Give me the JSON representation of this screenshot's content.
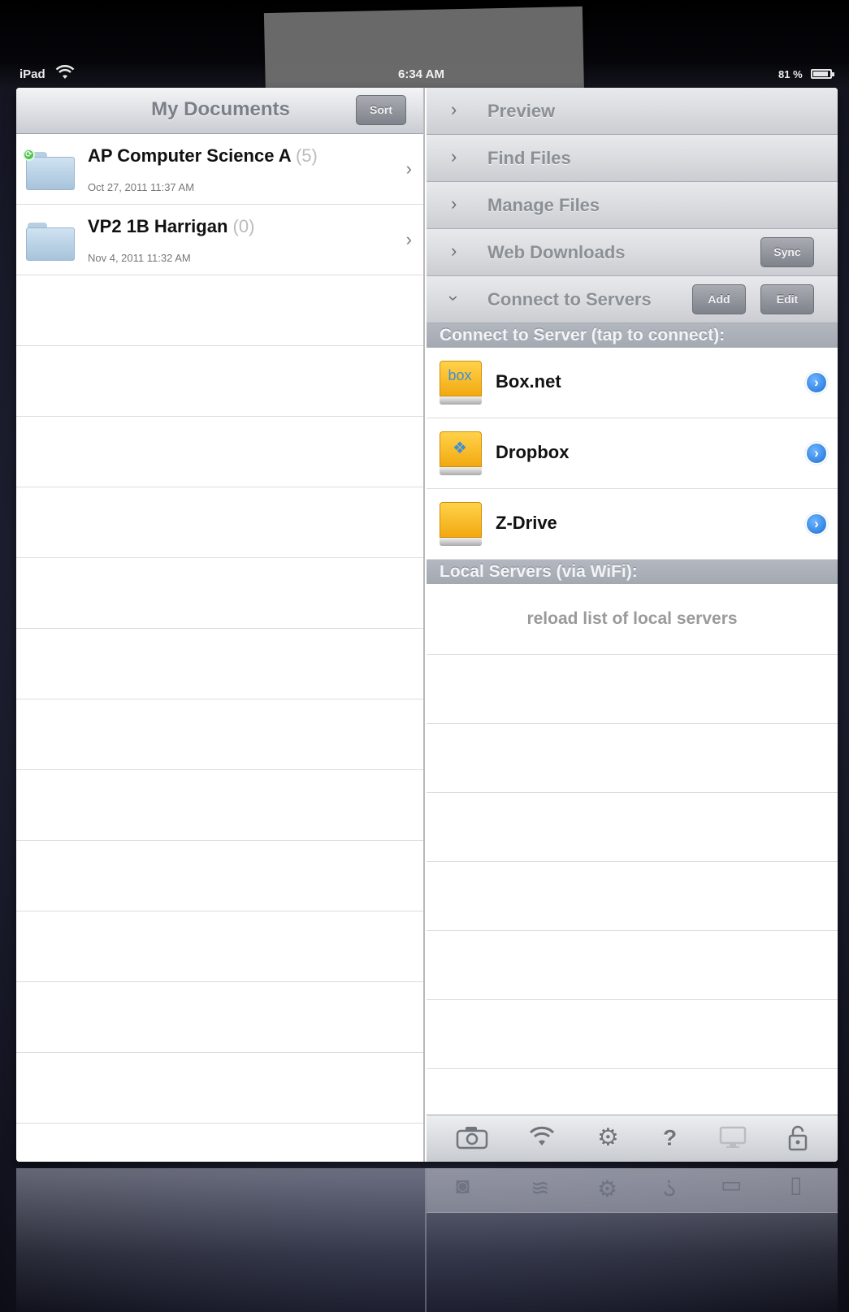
{
  "status_bar": {
    "carrier": "iPad",
    "time": "6:34 AM",
    "battery": "81 %"
  },
  "left_pane": {
    "title": "My Documents",
    "sort_label": "Sort",
    "documents": [
      {
        "name": "AP Computer Science A",
        "count": "(5)",
        "date": "Oct 27, 2011 11:37 AM",
        "synced": true
      },
      {
        "name": "VP2 1B Harrigan",
        "count": "(0)",
        "date": "Nov 4, 2011 11:32 AM",
        "synced": false
      }
    ]
  },
  "right_pane": {
    "sections": [
      {
        "label": "Preview",
        "chevron": ">"
      },
      {
        "label": "Find Files",
        "chevron": ">"
      },
      {
        "label": "Manage Files",
        "chevron": ">"
      },
      {
        "label": "Web Downloads",
        "chevron": ">",
        "button": "Sync"
      },
      {
        "label": "Connect to Servers",
        "chevron": "v",
        "buttons": [
          "Add",
          "Edit"
        ]
      }
    ],
    "connect_header": "Connect to Server (tap to connect):",
    "servers": [
      {
        "name": "Box.net",
        "icon": "box-drive-icon"
      },
      {
        "name": "Dropbox",
        "icon": "dropbox-drive-icon"
      },
      {
        "name": "Z-Drive",
        "icon": "drive-icon"
      }
    ],
    "local_header": "Local Servers (via WiFi):",
    "reload_label": "reload list of local servers"
  },
  "toolbar": {
    "icons": [
      "camera-icon",
      "wifi-icon",
      "gear-icon",
      "help-icon",
      "monitor-icon",
      "lock-icon"
    ]
  },
  "colors": {
    "accent_blue": "#1a6fd6",
    "folder_blue": "#a7c3db",
    "drive_orange": "#f2a911",
    "section_gray": "#a4a9b1"
  }
}
